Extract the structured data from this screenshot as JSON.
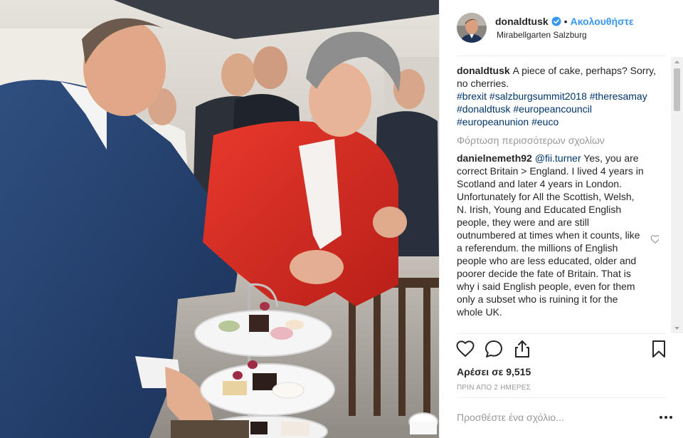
{
  "header": {
    "username": "donaldtusk",
    "separator": "•",
    "follow_label": "Ακολουθήστε",
    "location": "Mirabellgarten Salzburg",
    "avatar_icon": "avatar-photo",
    "verified_icon": "verified-badge-icon"
  },
  "caption": {
    "username": "donaldtusk",
    "text": "A piece of cake, perhaps? Sorry, no cherries.",
    "hashtags_line1": "#brexit #salzburgsummit2018 #theresamay",
    "hashtags_line2": "#donaldtusk #europeancouncil",
    "hashtags_line3": "#europeanunion #euco"
  },
  "load_more_label": "Φόρτωση περισσότερων σχολίων",
  "reply": {
    "username": "danielnemeth92",
    "mention": "@fii.turner",
    "text": "Yes, you are correct Britain > England. I lived 4 years in Scotland and later 4 years in London. Unfortunately for All the Scottish, Welsh, N. Irish, Young and Educated English people, they were and are still outnumbered at times when it counts, like a referendum. the millions of English people who are less educated, older and poorer decide the fate of Britain. That is why i said English people, even for them only a subset who is ruining it for the whole UK."
  },
  "actions": {
    "like_icon": "heart-icon",
    "comment_icon": "comment-bubble-icon",
    "share_icon": "share-icon",
    "save_icon": "bookmark-icon"
  },
  "likes_label": "Αρέσει σε 9,515",
  "timestamp": "ΠΡΙΝ ΑΠΟ 2 ΗΜΕΡΕΣ",
  "add_comment_placeholder": "Προσθέστε ένα σχόλιο...",
  "colors": {
    "link_blue": "#3897f0",
    "hashtag": "#003569",
    "muted": "#999999",
    "text": "#262626"
  }
}
